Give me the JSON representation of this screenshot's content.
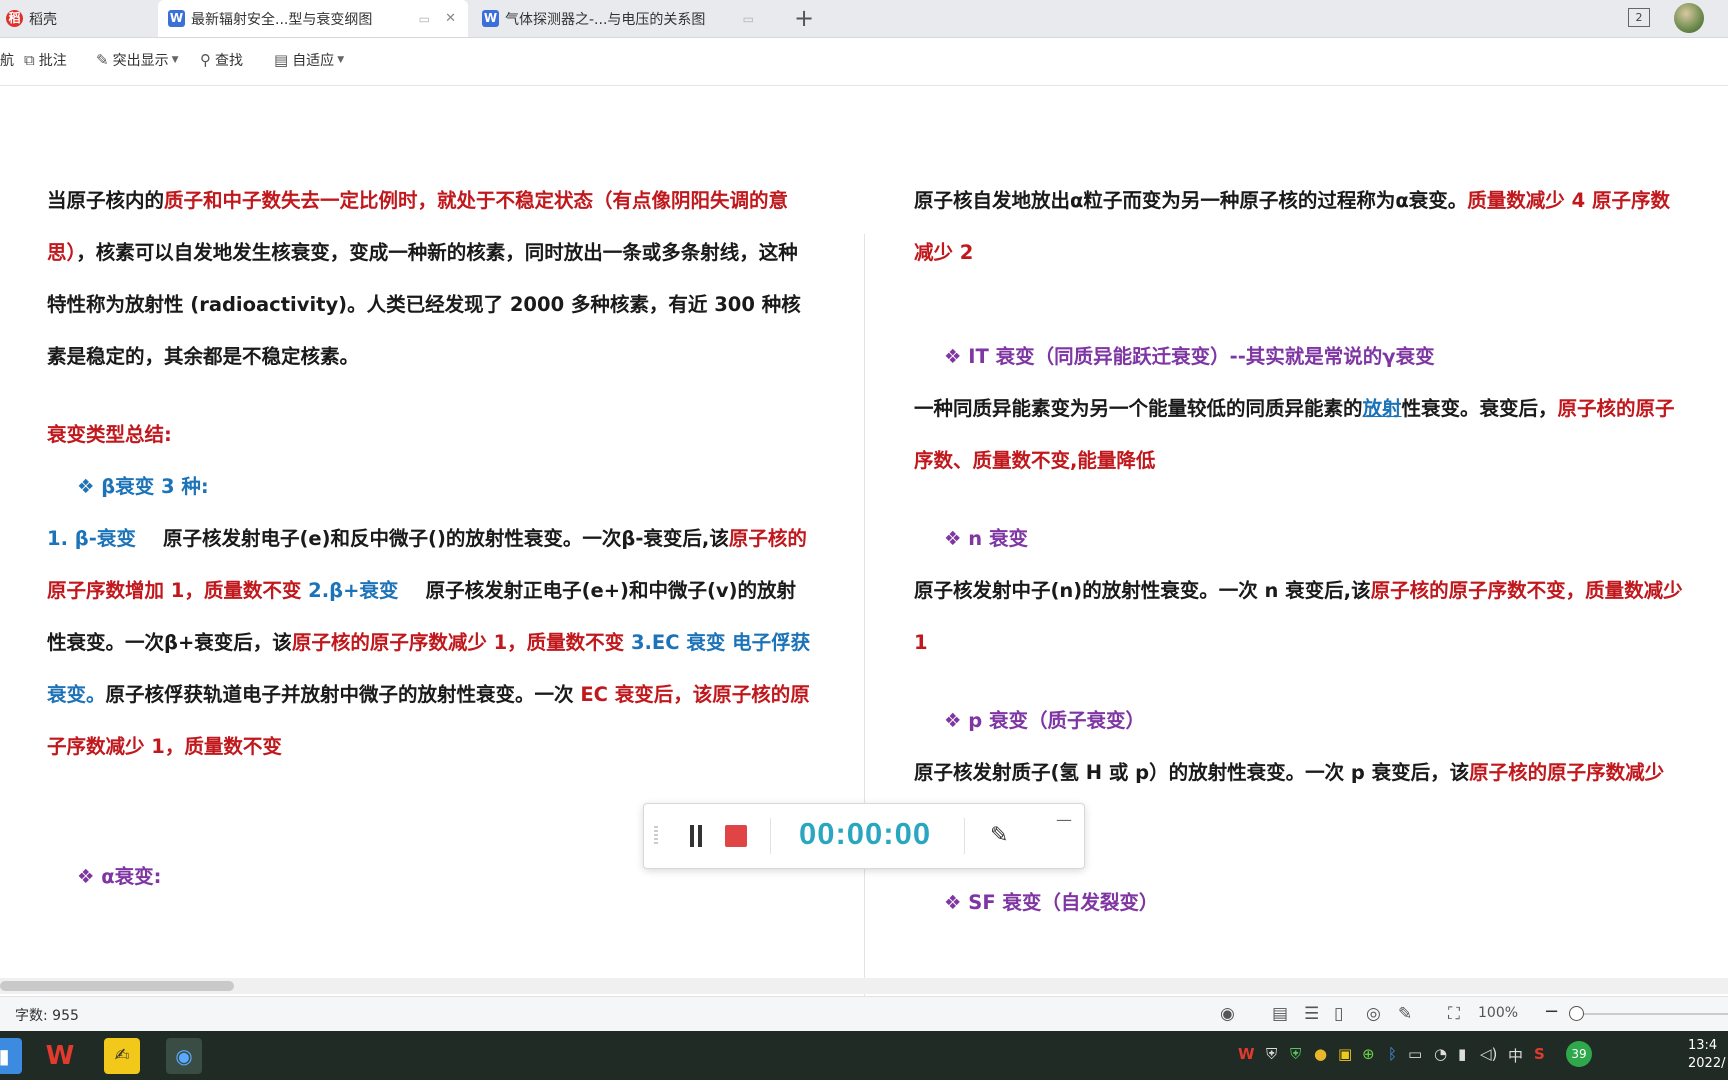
{
  "tabs": {
    "home": "稻壳",
    "doc1": "最新辐射安全...型与衰变纲图",
    "doc2": "气体探测器之-...与电压的关系图",
    "new_tab": "+",
    "window_count": "2"
  },
  "toolbar": {
    "nav_fragment": "航",
    "annotate": "批注",
    "highlight": "突出显示",
    "find": "查找",
    "adaptive": "自适应"
  },
  "left": {
    "p1_a": "当原子核内的",
    "p1_b": "质子和中子数失去一定比例时，就处于不稳定状态（有点像阴阳失调的意思）",
    "p1_c": "，核素可以自发地发生核衰变，变成一种新的核素，同时放出一条或多条射线，这种特性称为放射性 (radioactivity)。人类已经发现了 2000 多种核素，有近 300 种核素是稳定的，其余都是不稳定核素。",
    "summary": "衰变类型总结:",
    "beta_head": "❖ β衰变 3 种:",
    "b1_label": "1. β-衰变",
    "b1_text": "    原子核发射电子(e)和反中微子()的放射性衰变。一次β-衰变后,该",
    "b1_red": "原子核的原子序数增加 1，质量数不变",
    "b2_label": " 2.β+衰变",
    "b2_text": "    原子核发射正电子(e+)和中微子(v)的放射性衰变。一次β+衰变后，该",
    "b2_red": "原子核的原子序数减少 1，质量数不变",
    "b3_label": " 3.EC 衰变  电子俘获衰变。",
    "b3_text": "原子核俘获轨道电子并放射中微子的放射性衰变。一次 ",
    "b3_red": "EC 衰变后，该原子核的原子序数减少 1，质量数不变",
    "alpha_head": "❖ α衰变:"
  },
  "right": {
    "a_text": "原子核自发地放出α粒子而变为另一种原子核的过程称为α衰变。",
    "a_red": "质量数减少 4  原子序数减少 2",
    "it_head": "❖ IT 衰变（同质异能跃迁衰变）--其实就是常说的γ衰变",
    "it_text": "一种同质异能素变为另一个能量较低的同质异能素的",
    "it_link": "放射",
    "it_text2": "性衰变。衰变后，",
    "it_red": "原子核的原子序数、质量数不变,能量降低",
    "n_head": "❖ n 衰变",
    "n_text": "原子核发射中子(n)的放射性衰变。一次 n 衰变后,该",
    "n_red": "原子核的原子序数不变，质量数减少 1",
    "p_head": "❖ p 衰变（质子衰变）",
    "p_text_pre": "原子核发射质子(氢",
    "p_text": " H 或 p）的放射性衰变。一次 p 衰变后，该",
    "p_red": "原子核的原子序数减少 1，质量数减少 1",
    "sf_head": "❖ SF 衰变（自发裂变）"
  },
  "recorder": {
    "time": "00:00:00",
    "minimize": "—"
  },
  "status": {
    "word_count": "字数: 955",
    "zoom": "100%"
  },
  "taskbar": {
    "ime": "中",
    "badge": "39",
    "time": "13:4",
    "date": "2022/"
  }
}
